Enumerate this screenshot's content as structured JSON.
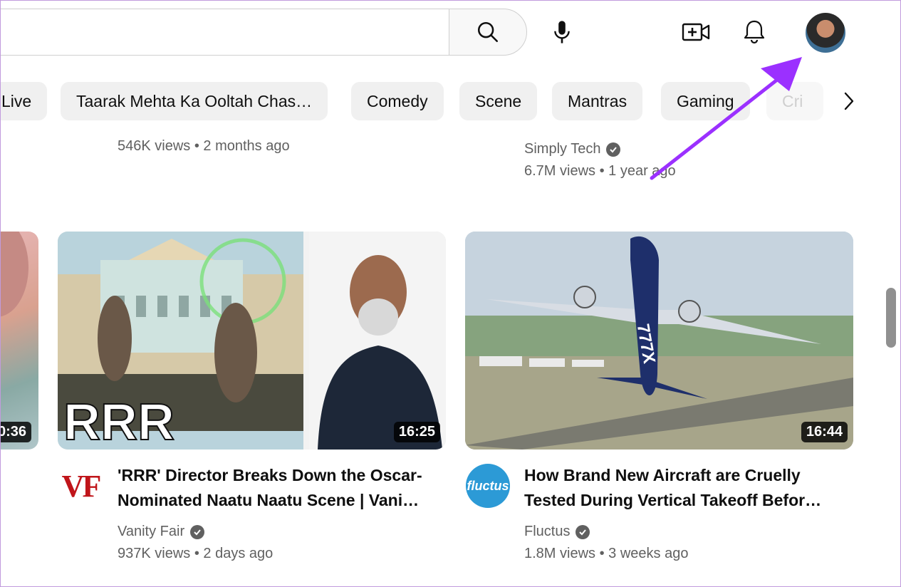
{
  "header": {
    "search_placeholder": "",
    "icons": [
      "search-icon",
      "mic-icon",
      "create-video-icon",
      "notifications-bell-icon",
      "profile-avatar"
    ]
  },
  "chips": [
    "Live",
    "Taarak Mehta Ka Ooltah Chas…",
    "Comedy",
    "Scene",
    "Mantras",
    "Gaming",
    "Cri"
  ],
  "prev_row": {
    "left_meta": "546K views • 2 months ago",
    "right_channel": "Simply Tech",
    "right_meta": "6.7M views • 1 year ago"
  },
  "videos": [
    {
      "duration": "0:36"
    },
    {
      "duration": "16:25",
      "thumbnail_text": "RRR",
      "channel_logo_text": "VF",
      "title_line1": "'RRR' Director Breaks Down the Oscar-",
      "title_line2": "Nominated Naatu Naatu Scene | Vani…",
      "channel": "Vanity Fair",
      "meta": "937K views • 2 days ago"
    },
    {
      "duration": "16:44",
      "thumbnail_text": "777X",
      "channel_logo_text": "fluctus",
      "title_line1": "How Brand New Aircraft are Cruelly",
      "title_line2": "Tested During Vertical Takeoff Befor…",
      "channel": "Fluctus",
      "meta": "1.8M views • 3 weeks ago"
    }
  ],
  "colors": {
    "annotation_arrow": "#9b30ff",
    "chip_bg": "#f0f0f0",
    "meta_text": "#606060"
  }
}
